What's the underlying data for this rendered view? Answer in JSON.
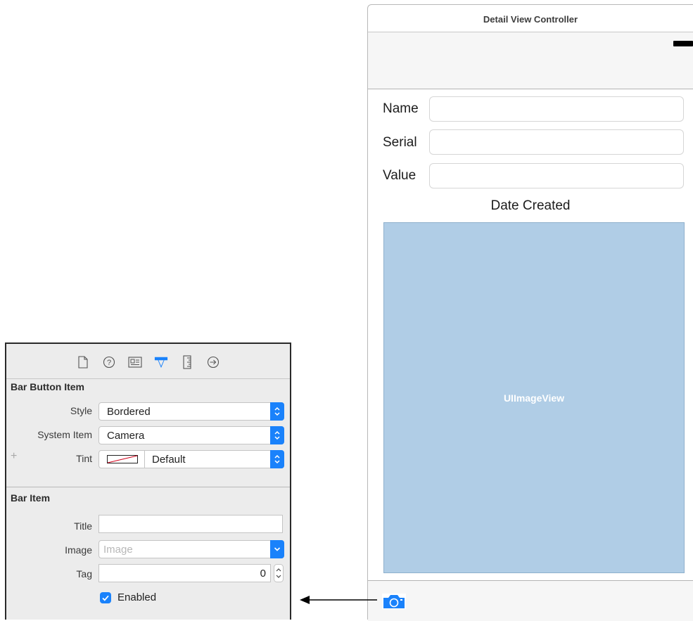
{
  "scene": {
    "title": "Detail View Controller",
    "fields": [
      {
        "label": "Name"
      },
      {
        "label": "Serial"
      },
      {
        "label": "Value"
      }
    ],
    "date_label": "Date Created",
    "image_view_label": "UIImageView",
    "toolbar_icon": "camera-icon"
  },
  "inspector": {
    "tabs": [
      "file-icon",
      "quick-help-icon",
      "identity-icon",
      "attributes-icon",
      "size-icon",
      "connections-icon"
    ],
    "active_tab": "attributes-icon",
    "accent_color": "#1a82fb",
    "bar_button_item": {
      "title": "Bar Button Item",
      "style_label": "Style",
      "style_value": "Bordered",
      "system_item_label": "System Item",
      "system_item_value": "Camera",
      "tint_label": "Tint",
      "tint_value": "Default",
      "plus_symbol": "+"
    },
    "bar_item": {
      "title": "Bar Item",
      "title_label": "Title",
      "title_value": "",
      "image_label": "Image",
      "image_placeholder": "Image",
      "tag_label": "Tag",
      "tag_value": "0",
      "enabled_label": "Enabled",
      "enabled": true
    }
  }
}
